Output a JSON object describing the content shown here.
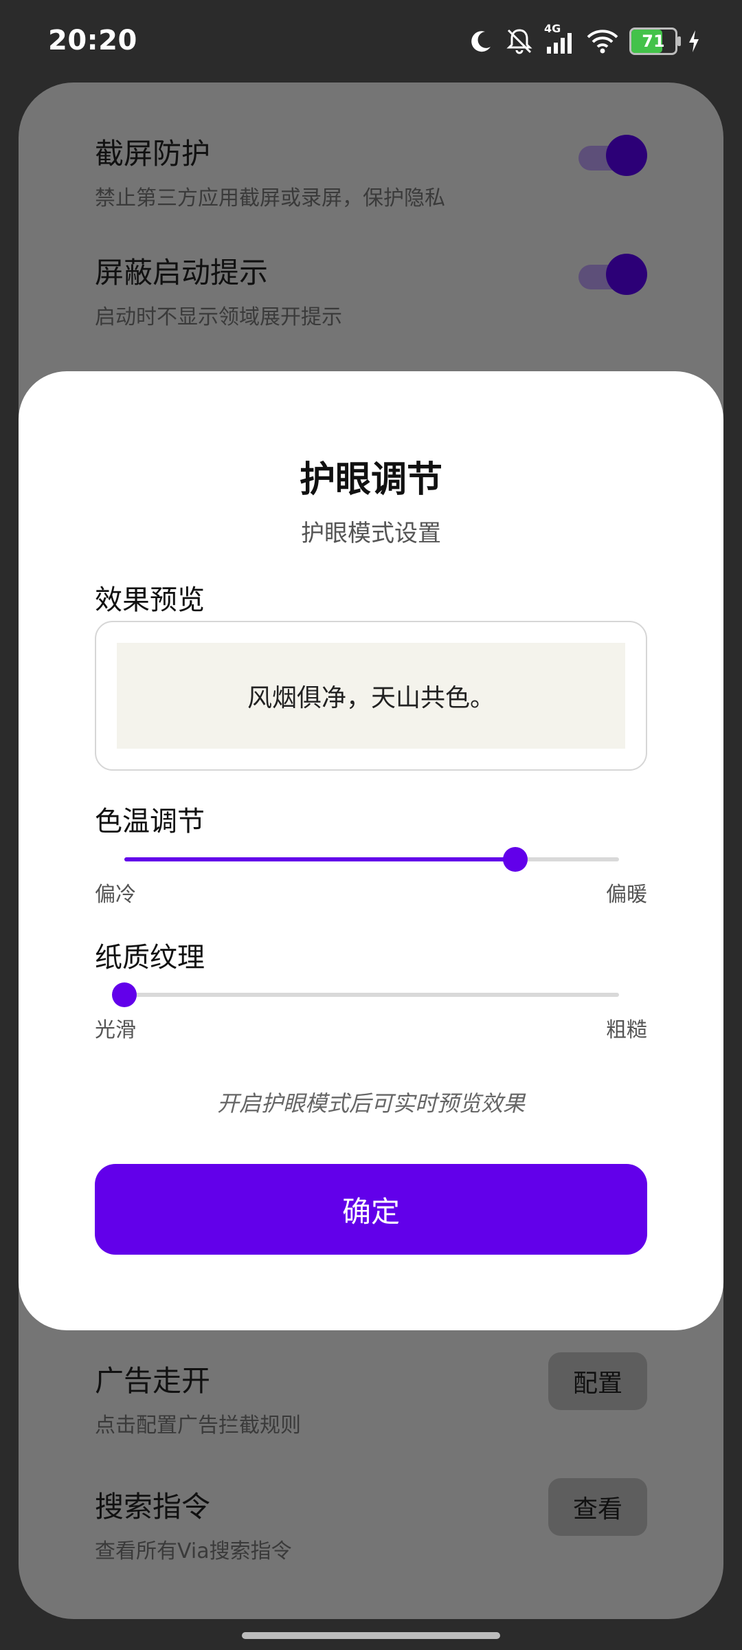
{
  "status_bar": {
    "time": "20:20",
    "network_label": "4G",
    "battery_level": "71",
    "battery_color": "#43c24a"
  },
  "background": {
    "rows": [
      {
        "title": "截屏防护",
        "desc": "禁止第三方应用截屏或录屏，保护隐私",
        "control": "toggle",
        "on": true
      },
      {
        "title": "屏蔽启动提示",
        "desc": "启动时不显示领域展开提示",
        "control": "toggle",
        "on": true
      },
      {
        "title": "广告走开",
        "desc": "点击配置广告拦截规则",
        "control": "button",
        "button_label": "配置"
      },
      {
        "title": "搜索指令",
        "desc": "查看所有Via搜索指令",
        "control": "button",
        "button_label": "查看"
      }
    ]
  },
  "dialog": {
    "title": "护眼调节",
    "subtitle": "护眼模式设置",
    "preview": {
      "label": "效果预览",
      "sample_text": "风烟俱净，天山共色。"
    },
    "color_temp": {
      "label": "色温调节",
      "min_label": "偏冷",
      "max_label": "偏暖",
      "value": 0.79
    },
    "texture": {
      "label": "纸质纹理",
      "min_label": "光滑",
      "max_label": "粗糙",
      "value": 0.0
    },
    "hint": "开启护眼模式后可实时预览效果",
    "confirm_label": "确定",
    "accent_color": "#6200ea"
  }
}
